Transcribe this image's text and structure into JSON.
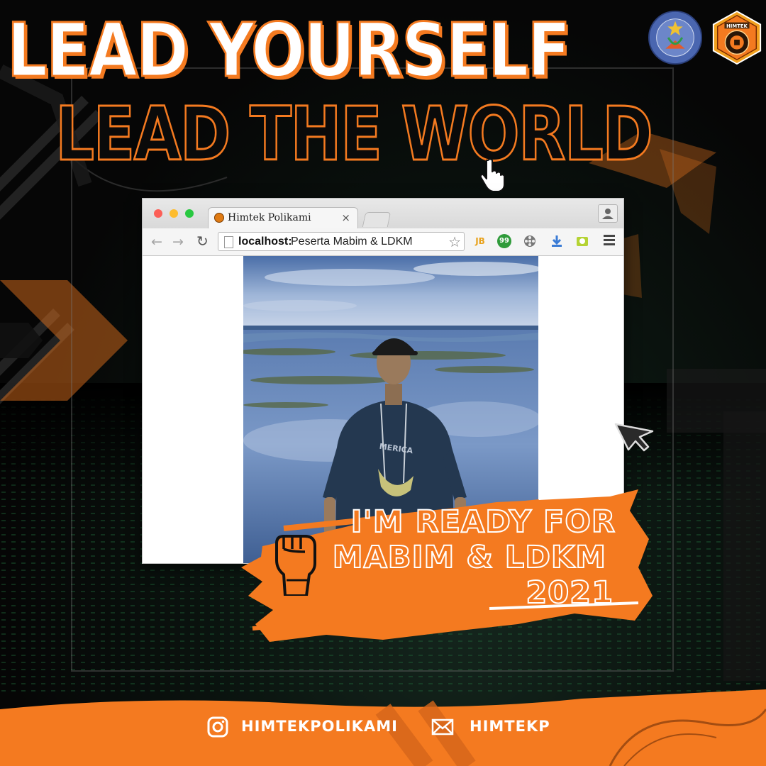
{
  "headline": {
    "line1": "LEAD YOURSELF",
    "line2": "LEAD THE WORLD"
  },
  "logos": {
    "left_icon": "polytechnic-seal-icon",
    "right_icon": "himtek-emblem-icon"
  },
  "browser": {
    "tab_title": "Himtek Polikami",
    "tab_close": "×",
    "url_host": "localhost:",
    "url_path": "Peserta Mabim & LDKM",
    "extensions": [
      "JB",
      "99"
    ]
  },
  "banner": {
    "line1": "I'M READY FOR",
    "line2": "MABIM & LDKM",
    "line3": "2021",
    "icon": "raised-fist-icon"
  },
  "footer": {
    "instagram": "HIMTEKPOLIKAMI",
    "email": "HIMTEKP"
  },
  "colors": {
    "accent": "#f47a20",
    "background": "#050505",
    "text": "#ffffff"
  }
}
